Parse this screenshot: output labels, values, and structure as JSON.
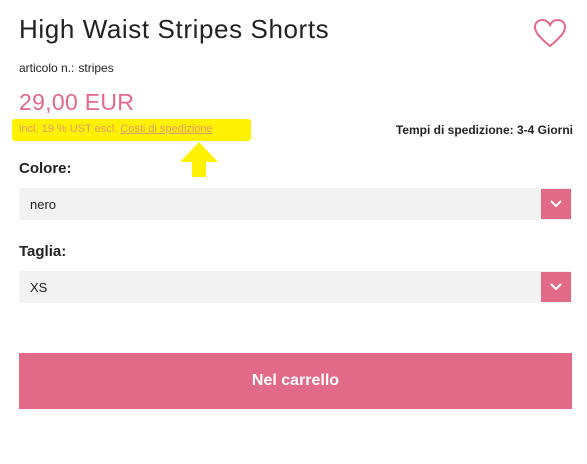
{
  "product": {
    "title": "High Waist Stripes Shorts",
    "sku_label": "articolo n.:",
    "sku_value": "stripes",
    "price": "29,00 EUR",
    "tax_prefix": "incl. 19 % UST escl.",
    "tax_link": "Costi di spedizione",
    "shipping": "Tempi di spedizione: 3-4 Giorni"
  },
  "options": {
    "color": {
      "label": "Colore:",
      "value": "nero"
    },
    "size": {
      "label": "Taglia:",
      "value": "XS"
    }
  },
  "actions": {
    "cart_label": "Nel carrello"
  },
  "icons": {
    "wishlist": "heart-icon",
    "dropdown": "chevron-down-icon",
    "annotation": "arrow-up-icon"
  },
  "colors": {
    "accent": "#e06a87",
    "highlight": "#fff200",
    "field_bg": "#f2f2f2"
  }
}
